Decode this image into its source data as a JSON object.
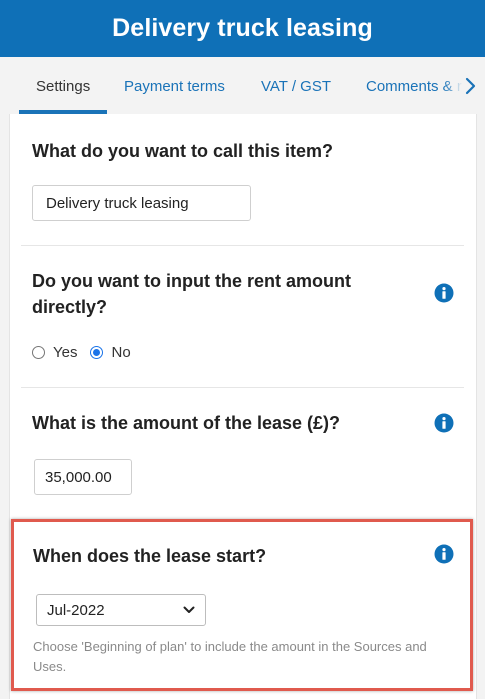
{
  "header": {
    "title": "Delivery truck leasing"
  },
  "tabs": [
    {
      "label": "Settings",
      "active": true
    },
    {
      "label": "Payment terms",
      "active": false
    },
    {
      "label": "VAT / GST",
      "active": false
    },
    {
      "label": "Comments & r",
      "active": false
    }
  ],
  "sections": {
    "name": {
      "question": "What do you want to call this item?",
      "value": "Delivery truck leasing"
    },
    "rent_direct": {
      "question": "Do you want to input the rent amount directly?",
      "options": [
        "Yes",
        "No"
      ],
      "selected": "No"
    },
    "lease_amount": {
      "question": "What is the amount of the lease (£)?",
      "value": "35,000.00"
    },
    "lease_start": {
      "question": "When does the lease start?",
      "selected": "Jul-2022",
      "hint": "Choose 'Beginning of plan' to include the amount in the Sources and Uses."
    }
  },
  "icons": {
    "info": "info-icon",
    "chevron": "chevron-right-icon",
    "select_arrow": "chevron-down-icon"
  },
  "colors": {
    "header_bg": "#0f70b7",
    "accent": "#1a73b8",
    "radio_accent": "#1a73e8",
    "highlight_border": "#e05a4e"
  }
}
